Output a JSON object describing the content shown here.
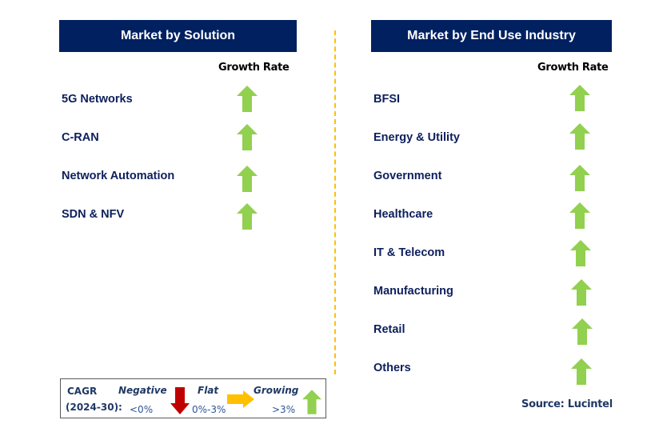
{
  "left_panel": {
    "title": "Market by Solution",
    "growth_rate_label": "Growth Rate",
    "items": [
      {
        "label": "5G Networks",
        "trend": "growing"
      },
      {
        "label": "C-RAN",
        "trend": "growing"
      },
      {
        "label": "Network Automation",
        "trend": "growing"
      },
      {
        "label": "SDN & NFV",
        "trend": "growing"
      }
    ]
  },
  "right_panel": {
    "title": "Market by End Use Industry",
    "growth_rate_label": "Growth Rate",
    "items": [
      {
        "label": "BFSI",
        "trend": "growing"
      },
      {
        "label": "Energy & Utility",
        "trend": "growing"
      },
      {
        "label": "Government",
        "trend": "growing"
      },
      {
        "label": "Healthcare",
        "trend": "growing"
      },
      {
        "label": "IT & Telecom",
        "trend": "growing"
      },
      {
        "label": "Manufacturing",
        "trend": "growing"
      },
      {
        "label": "Retail",
        "trend": "growing"
      },
      {
        "label": "Others",
        "trend": "growing"
      }
    ]
  },
  "legend": {
    "cagr_line1": "CAGR",
    "cagr_line2": "(2024-30):",
    "negative": {
      "label": "Negative",
      "range": "<0%",
      "icon": "arrow-down-icon",
      "color": "#c00000"
    },
    "flat": {
      "label": "Flat",
      "range": "0%-3%",
      "icon": "arrow-right-icon",
      "color": "#ffc000"
    },
    "growing": {
      "label": "Growing",
      "range": ">3%",
      "icon": "arrow-up-icon",
      "color": "#92d050"
    }
  },
  "source": "Source: Lucintel",
  "colors": {
    "header_bg": "#002060",
    "growing": "#92d050",
    "divider": "#ffc000",
    "item_text": "#0d1f5c"
  }
}
